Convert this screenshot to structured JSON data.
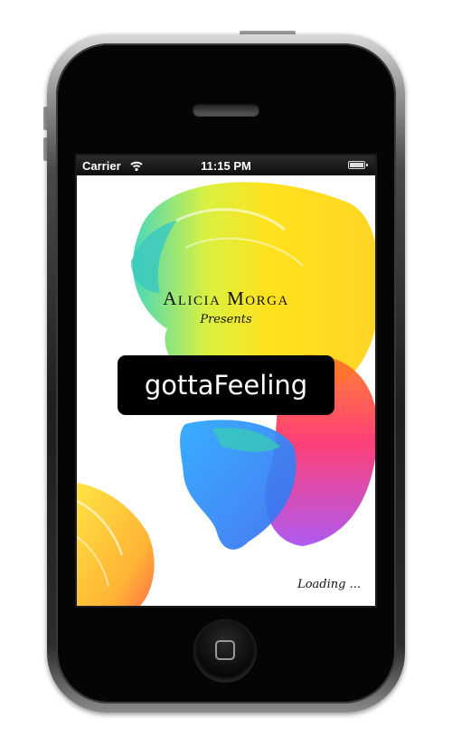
{
  "status_bar": {
    "carrier": "Carrier",
    "time": "11:15 PM",
    "wifi_icon": "wifi-icon",
    "battery_icon": "battery-icon"
  },
  "splash": {
    "presenter": "Alicia Morga",
    "presents": "Presents",
    "app_title": "gottaFeeling",
    "loading": "Loading ..."
  },
  "colors": {
    "title_background": "#000000",
    "title_text": "#ffffff",
    "screen_background": "#ffffff"
  }
}
